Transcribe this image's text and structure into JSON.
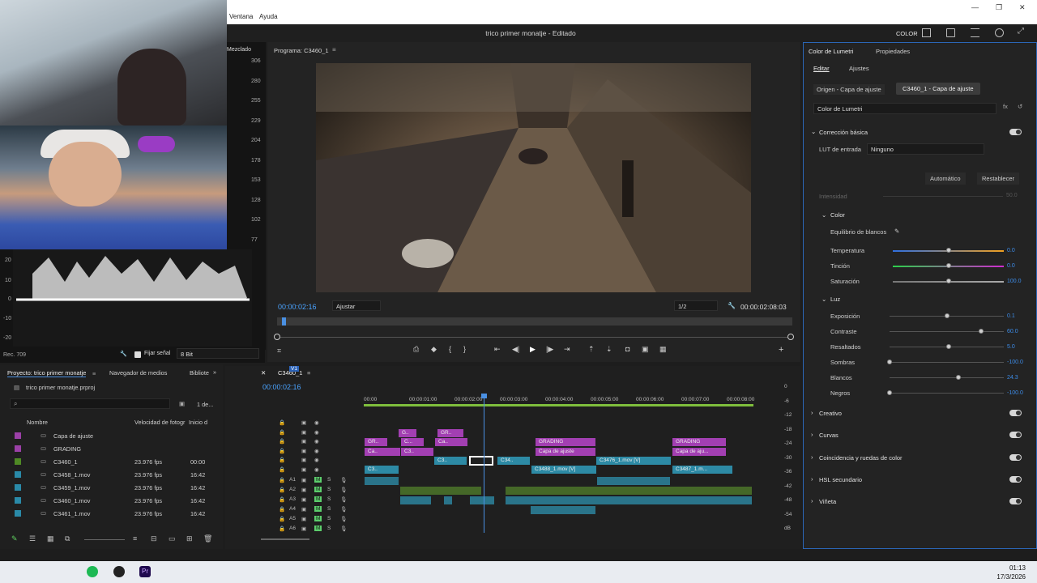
{
  "menubar": {
    "items": [
      "Ventana",
      "Ayuda"
    ]
  },
  "titlebar": {
    "title": "trico primer monatje - Editado",
    "workspace": "COLOR"
  },
  "meter": {
    "label": "Mezclado",
    "scale": [
      "306",
      "280",
      "255",
      "229",
      "204",
      "178",
      "153",
      "128",
      "102",
      "77",
      "51",
      "26",
      "0",
      "-26",
      "-51"
    ]
  },
  "scope": {
    "scale": [
      "20",
      "10",
      "0",
      "-10",
      "-20"
    ],
    "colorspace": "Rec. 709",
    "fix_signal_label": "Fijar señal",
    "bitdepth": "8 Bit"
  },
  "program": {
    "title": "Programa: C3460_1",
    "timecode": "00:00:02:16",
    "fit": "Ajustar",
    "resolution": "1/2",
    "duration": "00:00:02:08:03"
  },
  "project": {
    "tabs": [
      "Proyecto: trico primer monatje",
      "Navegador de medios",
      "Bibliote"
    ],
    "file": "trico primer monatje.prproj",
    "count": "1 de...",
    "columns": [
      "Nombre",
      "Velocidad de fotogr",
      "Inicio d"
    ],
    "rows": [
      {
        "name": "Capa de ajuste",
        "fps": "",
        "start": "",
        "color": "#9b40a7"
      },
      {
        "name": "GRADING",
        "fps": "",
        "start": "",
        "color": "#9b40a7"
      },
      {
        "name": "C3460_1",
        "fps": "23.976 fps",
        "start": "00:00",
        "color": "#4f8a25"
      },
      {
        "name": "C3458_1.mov",
        "fps": "23.976 fps",
        "start": "16:42",
        "color": "#2a8aa8"
      },
      {
        "name": "C3459_1.mov",
        "fps": "23.976 fps",
        "start": "16:42",
        "color": "#2a8aa8"
      },
      {
        "name": "C3460_1.mov",
        "fps": "23.976 fps",
        "start": "16:42",
        "color": "#2a8aa8"
      },
      {
        "name": "C3461_1.mov",
        "fps": "23.976 fps",
        "start": "16:42",
        "color": "#2a8aa8"
      }
    ]
  },
  "timeline": {
    "tab": "C3460_1",
    "timecode": "00:00:02:16",
    "ruler": [
      "00:00",
      "00:00:01:00",
      "00:00:02:00",
      "00:00:03:00",
      "00:00:04:00",
      "00:00:05:00",
      "00:00:06:00",
      "00:00:07:00",
      "00:00:08:00"
    ],
    "video_tracks": [
      "V6",
      "V5",
      "V4",
      "V3",
      "V2",
      "V1"
    ],
    "audio_tracks": [
      "A1",
      "A2",
      "A3",
      "A4",
      "A5",
      "A6"
    ],
    "clips": {
      "v5a": "G..",
      "v5b": "GR..",
      "v4a": "GR..",
      "v4b": "C...",
      "v4c": "Ca..",
      "grading1": "GRADING",
      "grading2": "GRADING",
      "v3a": "Ca..",
      "v3b": "C3..",
      "adj1": "Capa de ajuste",
      "adj2": "Capa de aju...",
      "v2a": "C3..",
      "v2b": "C34..",
      "v2c": "C3476_1.mov [V]",
      "v1a": "C3..",
      "v1b": "C3488_1.mov [V]",
      "v1c": "C3487_1.m..."
    },
    "meter_scale": [
      "0",
      "-6",
      "-12",
      "-18",
      "-24",
      "-30",
      "-36",
      "-42",
      "-48",
      "-54",
      "dB"
    ]
  },
  "lumetri": {
    "tabs": [
      "Color de Lumetri",
      "Propiedades"
    ],
    "subtabs": [
      "Editar",
      "Ajustes"
    ],
    "source_tab": "Origen - Capa de ajuste",
    "seq_tab": "C3460_1 - Capa de ajuste",
    "effect": "Color de Lumetri",
    "basic": "Corrección básica",
    "lut_label": "LUT de entrada",
    "lut_value": "Ninguno",
    "auto": "Automático",
    "reset": "Restablecer",
    "intensity": {
      "label": "Intensidad",
      "value": "50.0"
    },
    "color_section": "Color",
    "wb": "Equilibrio de blancos",
    "sliders": [
      {
        "label": "Temperatura",
        "value": "0.0",
        "pos": 0.5
      },
      {
        "label": "Tinción",
        "value": "0.0",
        "pos": 0.5
      },
      {
        "label": "Saturación",
        "value": "100.0",
        "pos": 0.5
      }
    ],
    "light_section": "Luz",
    "light": [
      {
        "label": "Exposición",
        "value": "0.1",
        "pos": 0.5
      },
      {
        "label": "Contraste",
        "value": "60.0",
        "pos": 0.8
      },
      {
        "label": "Resaltados",
        "value": "5.0",
        "pos": 0.52
      },
      {
        "label": "Sombras",
        "value": "-100.0",
        "pos": 0.0
      },
      {
        "label": "Blancos",
        "value": "24.3",
        "pos": 0.6
      },
      {
        "label": "Negros",
        "value": "-100.0",
        "pos": 0.0
      }
    ],
    "sections": [
      "Creativo",
      "Curvas",
      "Coincidencia y ruedas de color",
      "HSL secundario",
      "Viñeta"
    ]
  },
  "taskbar": {
    "time": "01:13",
    "date": "17/3/2026"
  }
}
